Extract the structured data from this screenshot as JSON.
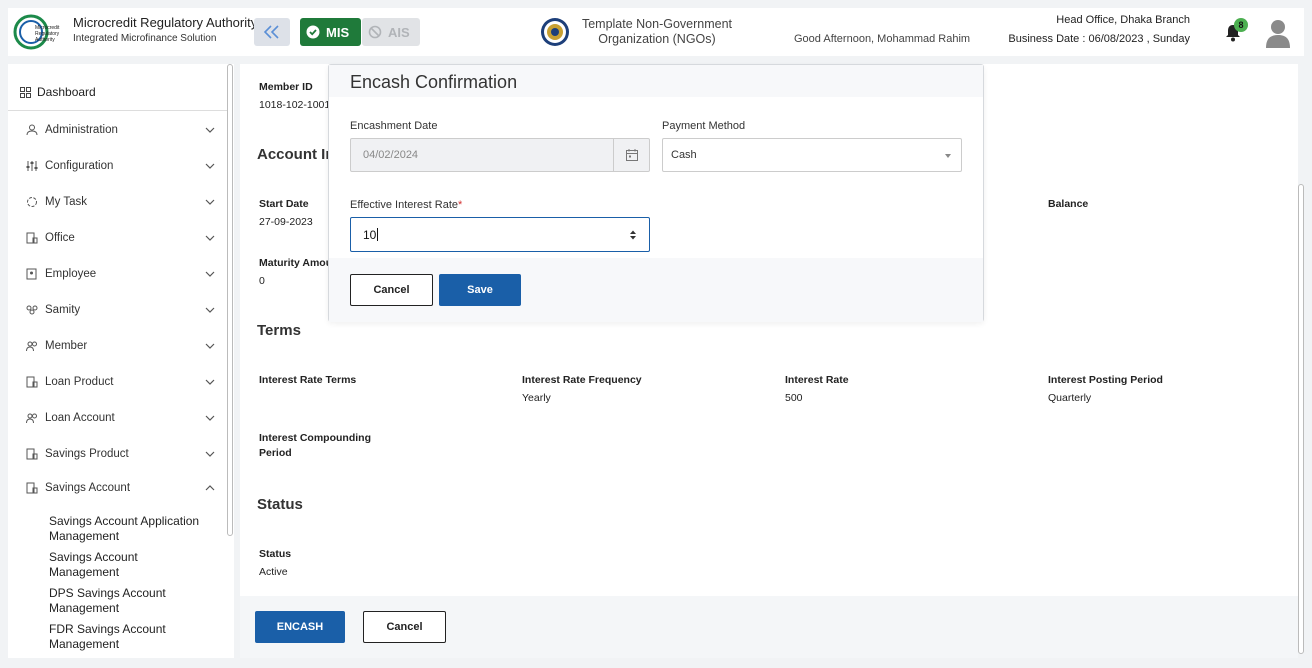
{
  "header": {
    "brand_title": "Microcredit Regulatory Authority",
    "brand_subtitle": "Integrated Microfinance Solution",
    "logo_text": "Microcredit Regulatory Authority",
    "mis_label": "MIS",
    "ais_label": "AIS",
    "org_name_line1": "Template Non-Government",
    "org_name_line2": "Organization (NGOs)",
    "greeting": "Good Afternoon, Mohammad Rahim",
    "branch": "Head Office, Dhaka Branch",
    "business_date": "Business Date : 06/08/2023 , Sunday",
    "notification_count": "8"
  },
  "sidebar": {
    "dashboard": "Dashboard",
    "items": [
      {
        "label": "Administration",
        "icon": "admin-icon"
      },
      {
        "label": "Configuration",
        "icon": "sliders-icon"
      },
      {
        "label": "My Task",
        "icon": "task-icon"
      },
      {
        "label": "Office",
        "icon": "office-icon"
      },
      {
        "label": "Employee",
        "icon": "employee-icon"
      },
      {
        "label": "Samity",
        "icon": "samity-icon"
      },
      {
        "label": "Member",
        "icon": "member-icon"
      },
      {
        "label": "Loan Product",
        "icon": "loan-product-icon"
      },
      {
        "label": "Loan Account",
        "icon": "loan-account-icon"
      },
      {
        "label": "Savings Product",
        "icon": "savings-product-icon"
      },
      {
        "label": "Savings Account",
        "icon": "savings-account-icon"
      }
    ],
    "subitems": [
      "Savings Account Application Management",
      "Savings Account Management",
      "DPS Savings Account Management",
      "FDR Savings Account Management"
    ]
  },
  "main": {
    "member_id_label": "Member ID",
    "member_id_value": "1018-102-1001",
    "account_info_heading": "Account In",
    "start_date_label": "Start Date",
    "start_date_value": "27-09-2023",
    "balance_label": "Balance",
    "maturity_label": "Maturity Amou",
    "maturity_value": "0",
    "terms_heading": "Terms",
    "terms": [
      {
        "label": "Interest Rate Terms",
        "value": ""
      },
      {
        "label": "Interest Rate Frequency",
        "value": "Yearly"
      },
      {
        "label": "Interest Rate",
        "value": "500"
      },
      {
        "label": "Interest Posting Period",
        "value": "Quarterly"
      }
    ],
    "compounding_label_1": "Interest Compounding",
    "compounding_label_2": "Period",
    "status_heading": "Status",
    "status_label": "Status",
    "status_value": "Active",
    "encash_label": "ENCASH",
    "cancel_label": "Cancel"
  },
  "modal": {
    "title": "Encash Confirmation",
    "encashment_date_label": "Encashment Date",
    "encashment_date_value": "04/02/2024",
    "payment_method_label": "Payment Method",
    "payment_method_value": "Cash",
    "rate_label": "Effective Interest Rate",
    "rate_required": "*",
    "rate_value": "10",
    "cancel_label": "Cancel",
    "save_label": "Save"
  },
  "colors": {
    "primary": "#1a5fa8",
    "mis_green": "#1f7a3a",
    "badge_green": "#4caf50"
  }
}
